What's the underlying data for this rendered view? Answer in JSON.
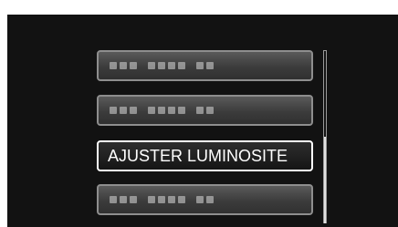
{
  "menu": {
    "items": [
      {
        "label": "",
        "selected": false
      },
      {
        "label": "",
        "selected": false
      },
      {
        "label": "AJUSTER LUMINOSITE",
        "selected": true
      },
      {
        "label": "",
        "selected": false
      }
    ]
  },
  "colors": {
    "background": "#121212",
    "item_border": "#8e8e8e",
    "selected_border": "#ffffff",
    "text": "#ffffff"
  },
  "scrollbar": {
    "position_fraction": 0.5
  }
}
